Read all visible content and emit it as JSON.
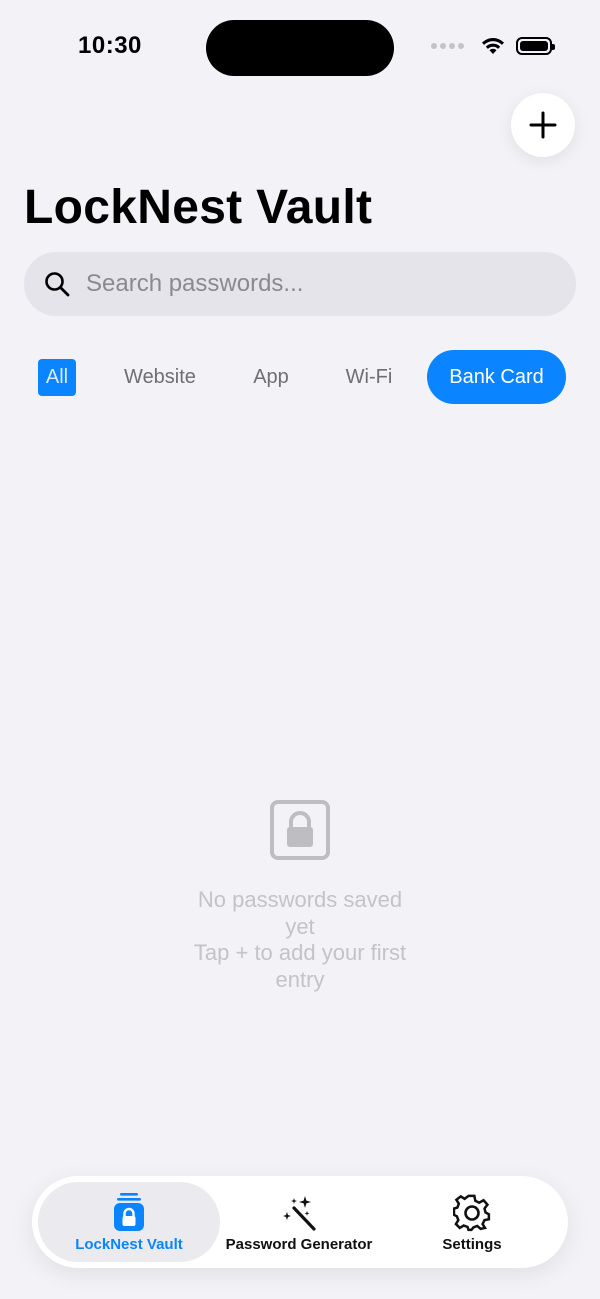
{
  "status_bar": {
    "time": "10:30"
  },
  "header": {
    "title": "LockNest Vault",
    "add_icon": "plus-icon"
  },
  "search": {
    "placeholder": "Search passwords...",
    "value": "",
    "icon": "search-icon"
  },
  "filters": {
    "items": [
      {
        "label": "All",
        "selected": false
      },
      {
        "label": "Website",
        "selected": false
      },
      {
        "label": "App",
        "selected": false
      },
      {
        "label": "Wi-Fi",
        "selected": false
      },
      {
        "label": "Bank Card",
        "selected": true
      }
    ]
  },
  "empty_state": {
    "icon": "lock-icon",
    "line1": "No passwords saved yet",
    "line2": "Tap + to add your first entry"
  },
  "tab_bar": {
    "tabs": [
      {
        "label": "LockNest Vault",
        "icon": "vault-lock-icon",
        "active": true
      },
      {
        "label": "Password Generator",
        "icon": "magic-wand-icon",
        "active": false
      },
      {
        "label": "Settings",
        "icon": "gear-icon",
        "active": false
      }
    ]
  },
  "colors": {
    "accent": "#0a84ff",
    "background": "#f2f2f7",
    "placeholder": "#8a8a8e",
    "empty_text": "#c3c3c8"
  }
}
